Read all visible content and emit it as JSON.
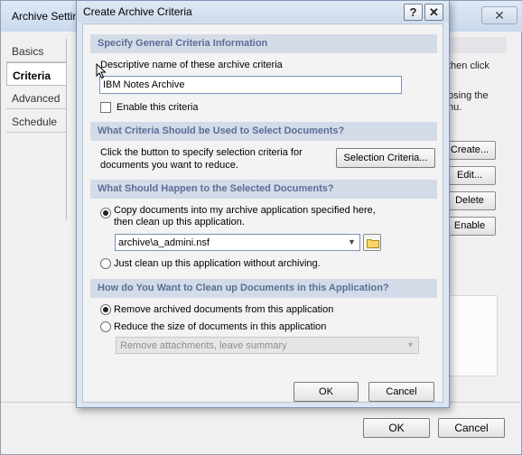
{
  "background_window": {
    "title": "Archive Settin",
    "close_glyph": "✕",
    "tabs": [
      {
        "label": "Basics"
      },
      {
        "label": "Criteria"
      },
      {
        "label": "Advanced"
      },
      {
        "label": "Schedule"
      }
    ],
    "fragments": {
      "then_click": "then click",
      "osing_the": "osing the",
      "nu": "nu."
    },
    "buttons": {
      "create": "Create...",
      "edit": "Edit...",
      "delete": "Delete",
      "enable": "Enable"
    },
    "footer": {
      "ok": "OK",
      "cancel": "Cancel"
    }
  },
  "dialog": {
    "title": "Create Archive Criteria",
    "help_glyph": "?",
    "close_glyph": "✕",
    "section1": {
      "heading": "Specify General Criteria Information",
      "name_label": "Descriptive name of these archive criteria",
      "name_value": "IBM Notes Archive",
      "enable_label": "Enable this criteria"
    },
    "section2": {
      "heading": "What Criteria Should be Used to Select Documents?",
      "description_line1": "Click the button to specify selection criteria for",
      "description_line2": "documents you want to reduce.",
      "button": "Selection Criteria..."
    },
    "section3": {
      "heading": "What Should Happen to the Selected Documents?",
      "option_copy_line1": "Copy documents into my archive application specified here,",
      "option_copy_line2": "then clean up this application.",
      "archive_path": "archive\\a_admini.nsf",
      "option_cleanup": "Just clean up this application without archiving."
    },
    "section4": {
      "heading": "How do You Want to Clean up Documents in this Application?",
      "option_remove": "Remove archived documents from this application",
      "option_reduce": "Reduce the size of documents in this application",
      "reduce_select": "Remove attachments, leave summary"
    },
    "footer": {
      "ok": "OK",
      "cancel": "Cancel"
    }
  }
}
